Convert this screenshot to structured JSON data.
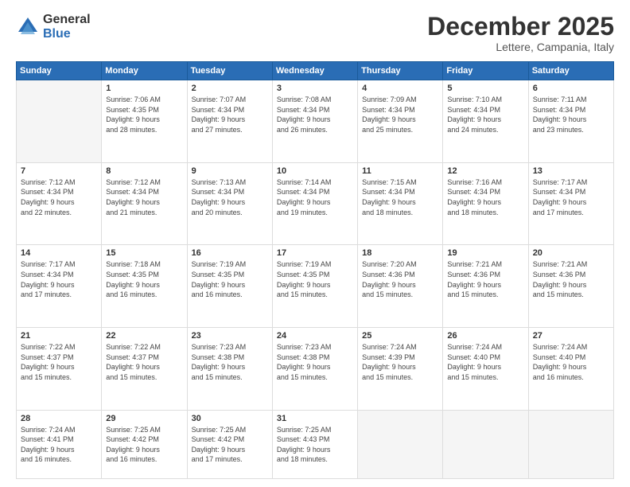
{
  "logo": {
    "general": "General",
    "blue": "Blue"
  },
  "title": "December 2025",
  "subtitle": "Lettere, Campania, Italy",
  "headers": [
    "Sunday",
    "Monday",
    "Tuesday",
    "Wednesday",
    "Thursday",
    "Friday",
    "Saturday"
  ],
  "weeks": [
    [
      {
        "day": "",
        "info": ""
      },
      {
        "day": "1",
        "info": "Sunrise: 7:06 AM\nSunset: 4:35 PM\nDaylight: 9 hours\nand 28 minutes."
      },
      {
        "day": "2",
        "info": "Sunrise: 7:07 AM\nSunset: 4:34 PM\nDaylight: 9 hours\nand 27 minutes."
      },
      {
        "day": "3",
        "info": "Sunrise: 7:08 AM\nSunset: 4:34 PM\nDaylight: 9 hours\nand 26 minutes."
      },
      {
        "day": "4",
        "info": "Sunrise: 7:09 AM\nSunset: 4:34 PM\nDaylight: 9 hours\nand 25 minutes."
      },
      {
        "day": "5",
        "info": "Sunrise: 7:10 AM\nSunset: 4:34 PM\nDaylight: 9 hours\nand 24 minutes."
      },
      {
        "day": "6",
        "info": "Sunrise: 7:11 AM\nSunset: 4:34 PM\nDaylight: 9 hours\nand 23 minutes."
      }
    ],
    [
      {
        "day": "7",
        "info": "Sunrise: 7:12 AM\nSunset: 4:34 PM\nDaylight: 9 hours\nand 22 minutes."
      },
      {
        "day": "8",
        "info": "Sunrise: 7:12 AM\nSunset: 4:34 PM\nDaylight: 9 hours\nand 21 minutes."
      },
      {
        "day": "9",
        "info": "Sunrise: 7:13 AM\nSunset: 4:34 PM\nDaylight: 9 hours\nand 20 minutes."
      },
      {
        "day": "10",
        "info": "Sunrise: 7:14 AM\nSunset: 4:34 PM\nDaylight: 9 hours\nand 19 minutes."
      },
      {
        "day": "11",
        "info": "Sunrise: 7:15 AM\nSunset: 4:34 PM\nDaylight: 9 hours\nand 18 minutes."
      },
      {
        "day": "12",
        "info": "Sunrise: 7:16 AM\nSunset: 4:34 PM\nDaylight: 9 hours\nand 18 minutes."
      },
      {
        "day": "13",
        "info": "Sunrise: 7:17 AM\nSunset: 4:34 PM\nDaylight: 9 hours\nand 17 minutes."
      }
    ],
    [
      {
        "day": "14",
        "info": "Sunrise: 7:17 AM\nSunset: 4:34 PM\nDaylight: 9 hours\nand 17 minutes."
      },
      {
        "day": "15",
        "info": "Sunrise: 7:18 AM\nSunset: 4:35 PM\nDaylight: 9 hours\nand 16 minutes."
      },
      {
        "day": "16",
        "info": "Sunrise: 7:19 AM\nSunset: 4:35 PM\nDaylight: 9 hours\nand 16 minutes."
      },
      {
        "day": "17",
        "info": "Sunrise: 7:19 AM\nSunset: 4:35 PM\nDaylight: 9 hours\nand 15 minutes."
      },
      {
        "day": "18",
        "info": "Sunrise: 7:20 AM\nSunset: 4:36 PM\nDaylight: 9 hours\nand 15 minutes."
      },
      {
        "day": "19",
        "info": "Sunrise: 7:21 AM\nSunset: 4:36 PM\nDaylight: 9 hours\nand 15 minutes."
      },
      {
        "day": "20",
        "info": "Sunrise: 7:21 AM\nSunset: 4:36 PM\nDaylight: 9 hours\nand 15 minutes."
      }
    ],
    [
      {
        "day": "21",
        "info": "Sunrise: 7:22 AM\nSunset: 4:37 PM\nDaylight: 9 hours\nand 15 minutes."
      },
      {
        "day": "22",
        "info": "Sunrise: 7:22 AM\nSunset: 4:37 PM\nDaylight: 9 hours\nand 15 minutes."
      },
      {
        "day": "23",
        "info": "Sunrise: 7:23 AM\nSunset: 4:38 PM\nDaylight: 9 hours\nand 15 minutes."
      },
      {
        "day": "24",
        "info": "Sunrise: 7:23 AM\nSunset: 4:38 PM\nDaylight: 9 hours\nand 15 minutes."
      },
      {
        "day": "25",
        "info": "Sunrise: 7:24 AM\nSunset: 4:39 PM\nDaylight: 9 hours\nand 15 minutes."
      },
      {
        "day": "26",
        "info": "Sunrise: 7:24 AM\nSunset: 4:40 PM\nDaylight: 9 hours\nand 15 minutes."
      },
      {
        "day": "27",
        "info": "Sunrise: 7:24 AM\nSunset: 4:40 PM\nDaylight: 9 hours\nand 16 minutes."
      }
    ],
    [
      {
        "day": "28",
        "info": "Sunrise: 7:24 AM\nSunset: 4:41 PM\nDaylight: 9 hours\nand 16 minutes."
      },
      {
        "day": "29",
        "info": "Sunrise: 7:25 AM\nSunset: 4:42 PM\nDaylight: 9 hours\nand 16 minutes."
      },
      {
        "day": "30",
        "info": "Sunrise: 7:25 AM\nSunset: 4:42 PM\nDaylight: 9 hours\nand 17 minutes."
      },
      {
        "day": "31",
        "info": "Sunrise: 7:25 AM\nSunset: 4:43 PM\nDaylight: 9 hours\nand 18 minutes."
      },
      {
        "day": "",
        "info": ""
      },
      {
        "day": "",
        "info": ""
      },
      {
        "day": "",
        "info": ""
      }
    ]
  ]
}
